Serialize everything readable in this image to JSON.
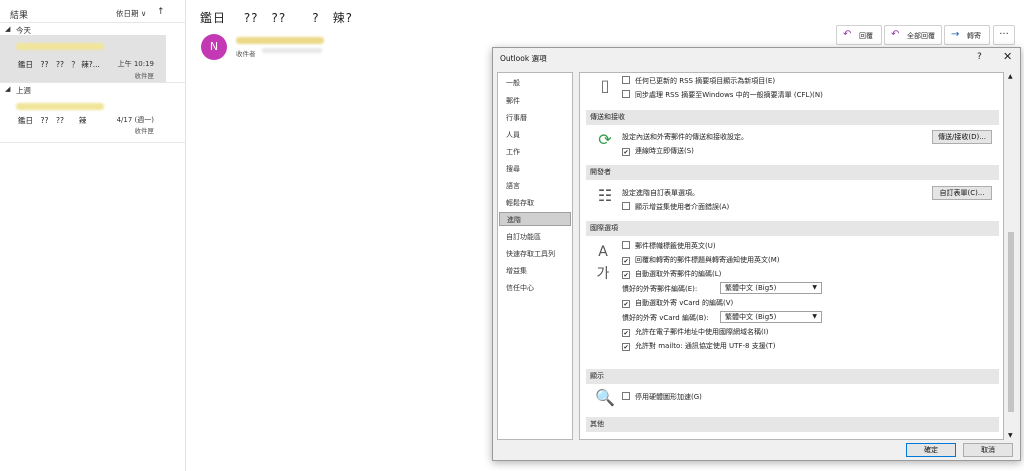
{
  "msglist": {
    "title": "結果",
    "sort_label": "依日期 ∨",
    "sort_arrow": "↑",
    "groups": [
      {
        "label": "今天",
        "items": [
          {
            "subject": "鑑日　??　??　？ 辣?...",
            "time": "上午 10:19",
            "folder": "收件匣"
          }
        ]
      },
      {
        "label": "上週",
        "items": [
          {
            "subject": "鑑日　??　??　　辣",
            "time": "4/17 (週一)",
            "folder": "收件匣"
          }
        ]
      }
    ]
  },
  "reading": {
    "subject": "鑑日　 ??　??　　?　辣?",
    "avatar_letter": "N",
    "to_label": "收件者",
    "actions": [
      {
        "icon": "reply-icon",
        "glyph": "↶",
        "label": "回覆"
      },
      {
        "icon": "reply-all-icon",
        "glyph": "↶",
        "label": "全部回覆"
      },
      {
        "icon": "forward-icon",
        "glyph": "→",
        "label": "轉寄"
      }
    ],
    "more": "···"
  },
  "dialog": {
    "title": "Outlook 選項",
    "help": "?",
    "close": "✕",
    "nav": [
      "一般",
      "郵件",
      "行事曆",
      "人員",
      "工作",
      "搜尋",
      "語言",
      "輕鬆存取",
      "進階",
      "自訂功能區",
      "快速存取工具列",
      "增益集",
      "信任中心"
    ],
    "nav_selected": 8,
    "rss": {
      "opt1": "任何已更新的 RSS 摘要項目顯示為新項目(E)",
      "opt2": "同步處理 RSS 摘要至Windows 中的一般摘要清單 (CFL)(N)"
    },
    "send_receive": {
      "header": "傳送和接收",
      "desc": "設定內送和外寄郵件的傳送和接收設定。",
      "button": "傳送/接收(D)...",
      "opt": "連線時立即傳送(S)"
    },
    "developer": {
      "header": "開發者",
      "desc": "設定進階自訂表單選項。",
      "button": "自訂表單(C)...",
      "opt": "顯示增益集使用者介面錯誤(A)"
    },
    "international": {
      "header": "國際選項",
      "opt1": "郵件標幟標籤使用英文(U)",
      "opt2": "回覆和轉寄的郵件標題與轉寄通知使用英文(M)",
      "opt3": "自動選取外寄郵件的編碼(L)",
      "enc_label": "慣好的外寄郵件編碼(E):",
      "enc_value": "繁體中文 (Big5)",
      "opt4": "自動選取外寄 vCard 的編碼(V)",
      "vcard_label": "慣好的外寄 vCard 編碼(B):",
      "vcard_value": "繁體中文 (Big5)",
      "opt5": "允許在電子郵件地址中使用國際網域名稱(I)",
      "opt6": "允許對 mailto: 通訊協定使用 UTF-8 支援(T)"
    },
    "display": {
      "header": "顯示",
      "opt": "停用硬體圖形加速(G)"
    },
    "other": {
      "header": "其他"
    },
    "ok": "確定",
    "cancel": "取消"
  }
}
